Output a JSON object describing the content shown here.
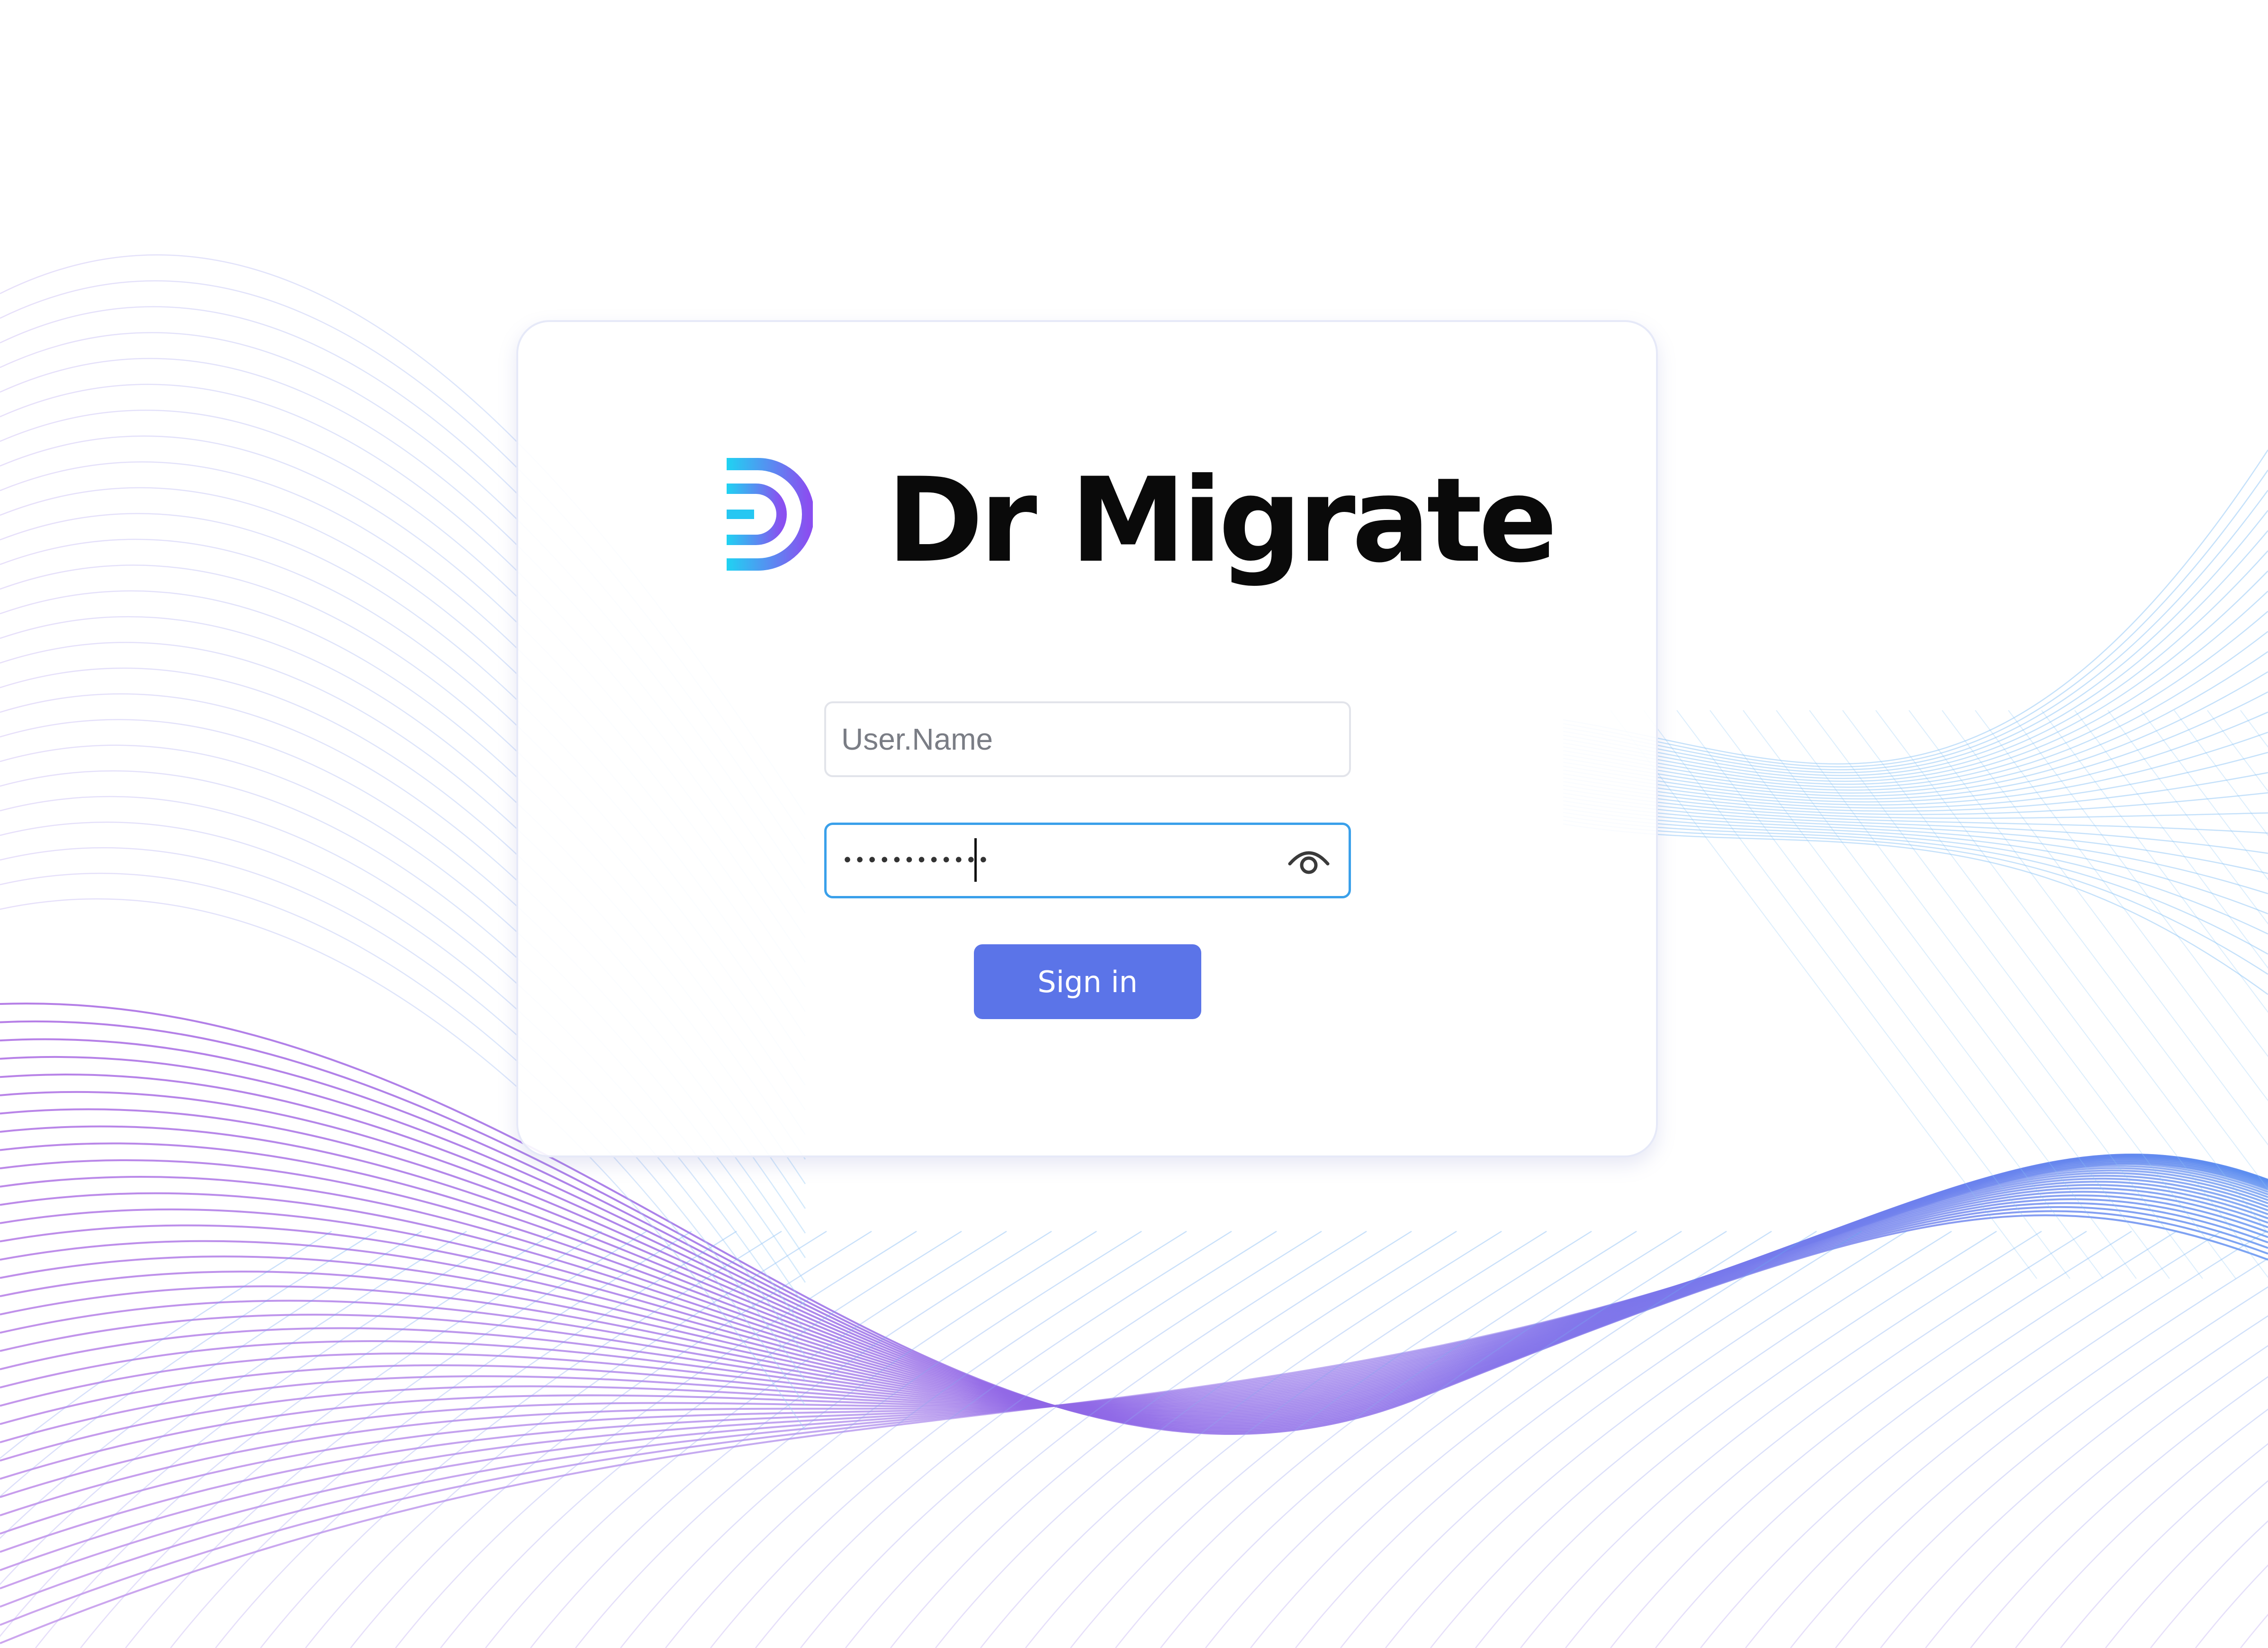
{
  "colors": {
    "background": "#ffffff",
    "accent": "#5b74e8",
    "focus_border": "#3aa0ea",
    "wave_purple": "#a35de0",
    "wave_blue": "#5b8ef0"
  },
  "brand": {
    "name": "Dr Migrate",
    "logo_icon": "dr-migrate-d-logo-icon"
  },
  "login": {
    "username": {
      "value": "",
      "placeholder": "User.Name"
    },
    "password": {
      "masked_value": "••••••••••••",
      "toggle_icon": "eye-icon"
    },
    "signin_label": "Sign in"
  }
}
